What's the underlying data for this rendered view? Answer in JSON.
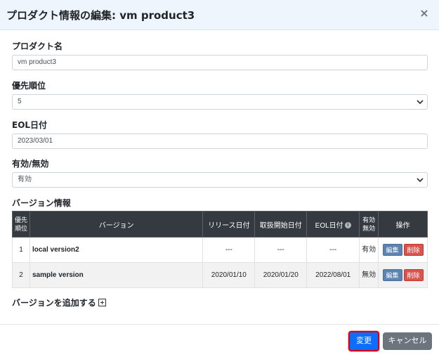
{
  "header": {
    "title": "プロダクト情報の編集: vm product3",
    "close_symbol": "×"
  },
  "form": {
    "product_name": {
      "label": "プロダクト名",
      "value": "vm product3"
    },
    "priority": {
      "label": "優先順位",
      "value": "5"
    },
    "eol_date": {
      "label": "EOL日付",
      "value": "2023/03/01"
    },
    "status": {
      "label": "有効/無効",
      "value": "有効"
    }
  },
  "versions": {
    "section_label": "バージョン情報",
    "headers": {
      "priority": "優先順位",
      "version": "バージョン",
      "release_date": "リリース日付",
      "handling_start": "取扱開始日付",
      "eol_date": "EOL日付",
      "status": "有効無効",
      "actions": "操作"
    },
    "rows": [
      {
        "priority": "1",
        "version": "local version2",
        "release_date": "---",
        "handling_start": "---",
        "eol_date": "---",
        "status": "有効",
        "edit": "編集",
        "delete": "削除"
      },
      {
        "priority": "2",
        "version": "sample version",
        "release_date": "2020/01/10",
        "handling_start": "2020/01/20",
        "eol_date": "2022/08/01",
        "status": "無効",
        "edit": "編集",
        "delete": "削除"
      }
    ],
    "add_label": "バージョンを追加する"
  },
  "footer": {
    "save_label": "変更",
    "cancel_label": "キャンセル"
  },
  "colors": {
    "primary": "#0d6efd",
    "danger": "#d9534f",
    "secondary": "#6c757d",
    "table_header": "#343a40"
  }
}
